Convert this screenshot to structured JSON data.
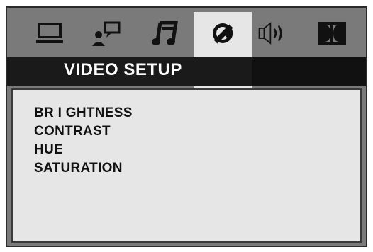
{
  "tabs": [
    {
      "icon": "monitor-icon",
      "label": ""
    },
    {
      "icon": "language-icon",
      "label": ""
    },
    {
      "icon": "audio-note-icon",
      "label": ""
    },
    {
      "icon": "video-setup-icon",
      "label": "",
      "active": true
    },
    {
      "icon": "speaker-icon",
      "label": ""
    },
    {
      "icon": "dolby-icon",
      "label": ""
    }
  ],
  "header": {
    "title": "VIDEO SETUP"
  },
  "menu": {
    "items": [
      {
        "label": "BR I GHTNESS"
      },
      {
        "label": "CONTRAST"
      },
      {
        "label": "HUE"
      },
      {
        "label": "SATURATION"
      }
    ]
  },
  "colors": {
    "frame_bg": "#7a7a7a",
    "panel_bg": "#e6e6e6",
    "header_bg": "#1a1a1a",
    "text": "#111111",
    "title_text": "#ffffff"
  }
}
